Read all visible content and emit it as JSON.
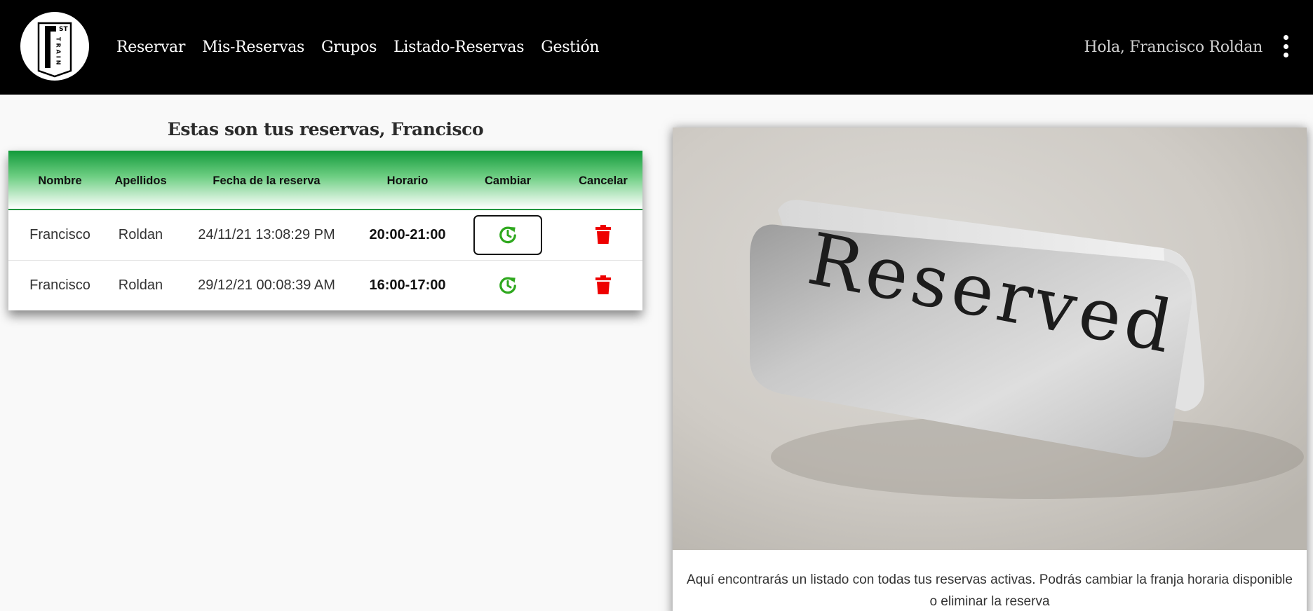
{
  "nav": {
    "logo": {
      "letters": "TRAIN",
      "superscript": "ST"
    },
    "links": [
      "Reservar",
      "Mis-Reservas",
      "Grupos",
      "Listado-Reservas",
      "Gestión"
    ],
    "greeting": "Hola, Francisco Roldan"
  },
  "reservations": {
    "title": "Estas son tus reservas, Francisco",
    "columns": [
      "Nombre",
      "Apellidos",
      "Fecha de la reserva",
      "Horario",
      "Cambiar",
      "Cancelar"
    ],
    "rows": [
      {
        "nombre": "Francisco",
        "apellidos": "Roldan",
        "fecha": "24/11/21 13:08:29 PM",
        "horario": "20:00-21:00"
      },
      {
        "nombre": "Francisco",
        "apellidos": "Roldan",
        "fecha": "29/12/21 00:08:39 AM",
        "horario": "16:00-17:00"
      }
    ]
  },
  "card": {
    "image_text": "Reserved",
    "description": "Aquí encontrarás un listado con todas tus reservas activas. Podrás cambiar la franja horaria disponible o eliminar la reserva"
  },
  "colors": {
    "navbar": "#000000",
    "header_green": "#129a3a",
    "change_icon": "#2fa81e",
    "delete_icon": "#ee0000"
  },
  "icons": {
    "change": "clock-refresh-icon",
    "delete": "trash-icon",
    "menu": "kebab-menu-icon"
  }
}
